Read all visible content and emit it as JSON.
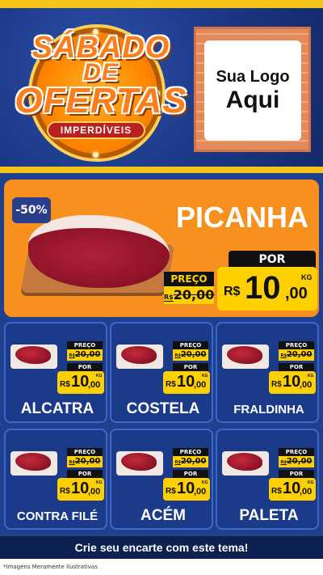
{
  "header": {
    "title_line1": "SÁBADO",
    "title_line2": "DE",
    "title_line3": "OFERTAS",
    "subtitle": "IMPERDÍVEIS",
    "logo_line1": "Sua Logo",
    "logo_line2": "Aqui"
  },
  "featured": {
    "discount": "-50%",
    "name": "PICANHA",
    "preco_label": "PREÇO",
    "old_currency": "R$",
    "old_price": "20,00",
    "por_label": "POR",
    "currency": "R$",
    "price_int": "10",
    "price_dec": ",00",
    "unit": "KG"
  },
  "products": [
    {
      "name": "ALCATRA",
      "preco_label": "PREÇO",
      "old_currency": "R$",
      "old_price": "20,00",
      "por_label": "POR",
      "currency": "R$",
      "price_int": "10",
      "price_dec": ",00",
      "unit": "KG"
    },
    {
      "name": "COSTELA",
      "preco_label": "PREÇO",
      "old_currency": "R$",
      "old_price": "20,00",
      "por_label": "POR",
      "currency": "R$",
      "price_int": "10",
      "price_dec": ",00",
      "unit": "KG"
    },
    {
      "name": "FRALDINHA",
      "preco_label": "PREÇO",
      "old_currency": "R$",
      "old_price": "20,00",
      "por_label": "POR",
      "currency": "R$",
      "price_int": "10",
      "price_dec": ",00",
      "unit": "KG"
    },
    {
      "name": "CONTRA FILÉ",
      "preco_label": "PREÇO",
      "old_currency": "R$",
      "old_price": "20,00",
      "por_label": "POR",
      "currency": "R$",
      "price_int": "10",
      "price_dec": ",00",
      "unit": "KG"
    },
    {
      "name": "ACÉM",
      "preco_label": "PREÇO",
      "old_currency": "R$",
      "old_price": "20,00",
      "por_label": "POR",
      "currency": "R$",
      "price_int": "10",
      "price_dec": ",00",
      "unit": "KG"
    },
    {
      "name": "PALETA",
      "preco_label": "PREÇO",
      "old_currency": "R$",
      "old_price": "20,00",
      "por_label": "POR",
      "currency": "R$",
      "price_int": "10",
      "price_dec": ",00",
      "unit": "KG"
    }
  ],
  "footer": {
    "cta": "Crie seu encarte com este tema!",
    "disclaimer": "*Imagens Meramente Ilustrativas"
  },
  "colors": {
    "background": "#1f3f8f",
    "accent_yellow": "#ffd000",
    "featured_orange": "#f7901e",
    "card_blue": "#1b3a8a"
  }
}
